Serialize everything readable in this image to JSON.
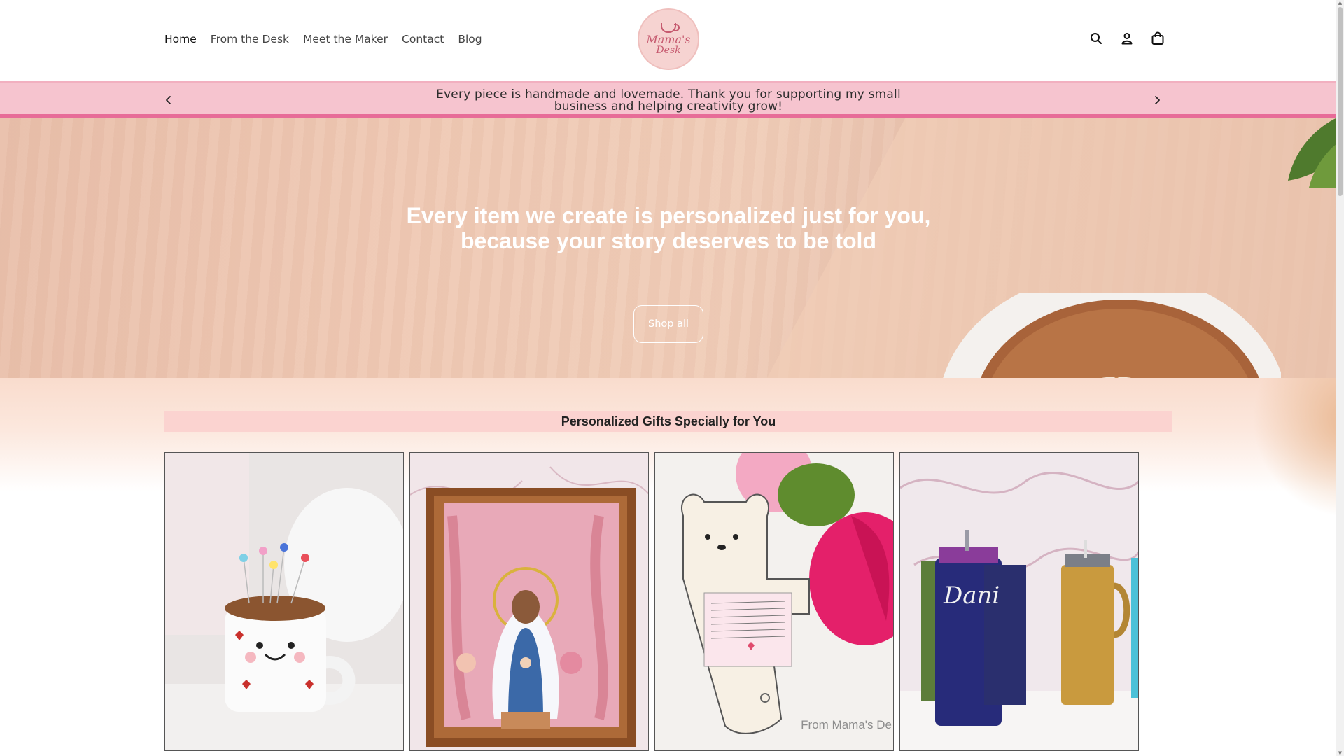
{
  "nav": {
    "items": [
      {
        "label": "Home",
        "active": true
      },
      {
        "label": "From the Desk"
      },
      {
        "label": "Meet the Maker"
      },
      {
        "label": "Contact"
      },
      {
        "label": "Blog"
      }
    ]
  },
  "logo": {
    "line1": "Mama's",
    "line2": "Desk"
  },
  "header_icons": [
    "search-icon",
    "account-icon",
    "cart-icon"
  ],
  "announcement": {
    "text": "Every piece is handmade and lovemade. Thank you for supporting my small business and helping creativity grow!"
  },
  "hero": {
    "heading": "Every item we create is personalized just for you, because your story deserves to be told",
    "button_label": "Shop all"
  },
  "collection": {
    "title": "Personalized Gifts Specially for You",
    "products": [
      {
        "image": "mug-pincushion"
      },
      {
        "image": "virgin-mary-shadowbox"
      },
      {
        "image": "bear-card",
        "watermark": "From Mama's De"
      },
      {
        "image": "personalized-tumblers",
        "name_on_tumbler": "Dani"
      }
    ]
  },
  "colors": {
    "announcement_bg": "#f6c4cf",
    "announcement_border": "#e76c98",
    "section_title_bg": "#fbd3d0",
    "logo_bg": "#f6d3d1",
    "logo_text": "#c65a6f"
  }
}
